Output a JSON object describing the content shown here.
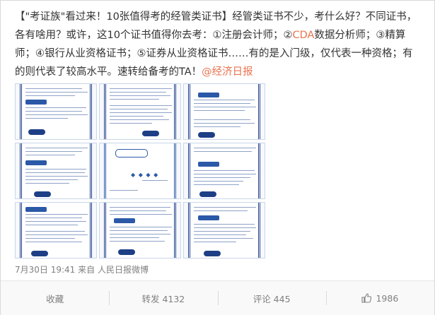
{
  "post": {
    "lead": "【\"考证族\"看过来！10张值得考的经管类证书】经管类证书不少，考什么好？不同证书，各有啥用？或许，这10个证书值得你去考：①注册会计师；②",
    "link_text": "CDA",
    "tail": "数据分析师；③精算师；④银行从业资格证书；⑤证券从业资格证书……有的是入门级，仅代表一种资格；有的则代表了较高水平。速转给备考的TA！",
    "mention": "@经济日报"
  },
  "meta": {
    "time": "7月30日 19:41",
    "source_prefix": "来自",
    "source": "人民日报微博"
  },
  "actions": {
    "favorite": "收藏",
    "repost": "转发 4132",
    "comment": "评论 445",
    "like": "1986"
  },
  "colors": {
    "link": "#eb7350",
    "text": "#333333",
    "muted": "#808080",
    "frame": "#1f3f8a"
  }
}
